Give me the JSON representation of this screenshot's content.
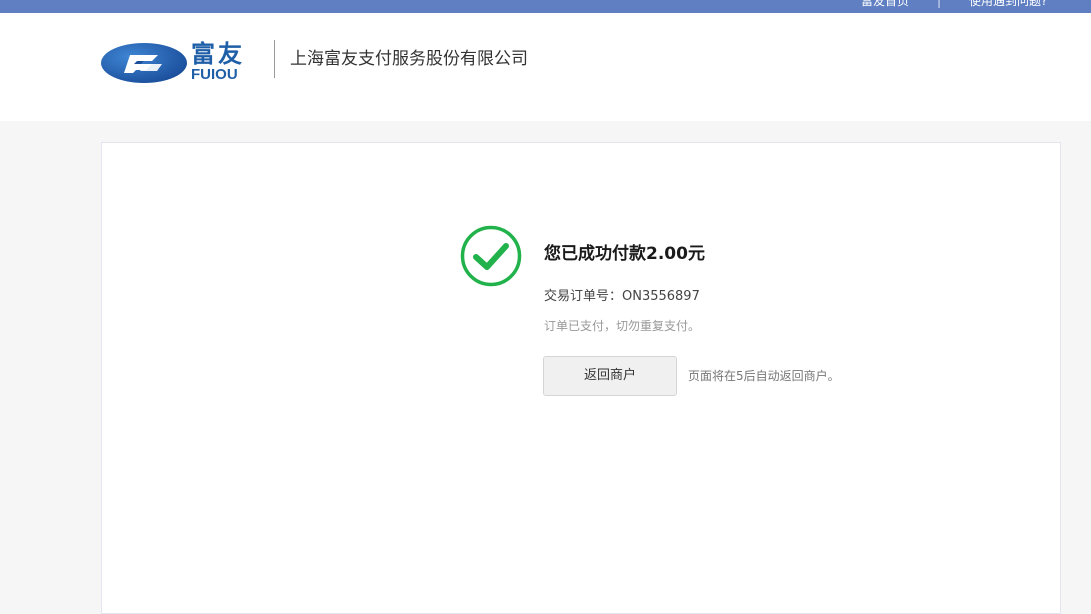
{
  "topbar": {
    "home_link": "富友首页",
    "separator": "|",
    "help_link": "使用遇到问题?"
  },
  "header": {
    "logo": {
      "chinese": "富友",
      "english": "FUIOU",
      "icon": "fuiou-emblem-icon"
    },
    "company_name": "上海富友支付服务股份有限公司"
  },
  "result": {
    "icon": "check-circle-icon",
    "title": "您已成功付款2.00元",
    "order_line": "交易订单号：ON3556897",
    "notice": "订单已支付，切勿重复支付。",
    "return_button": "返回商户",
    "redirect_note": "页面将在5后自动返回商户。"
  },
  "colors": {
    "topbar": "#5f7fc2",
    "brand_blue": "#1f5fa8",
    "success_green": "#21b24b",
    "page_background": "#f6f6f7"
  }
}
